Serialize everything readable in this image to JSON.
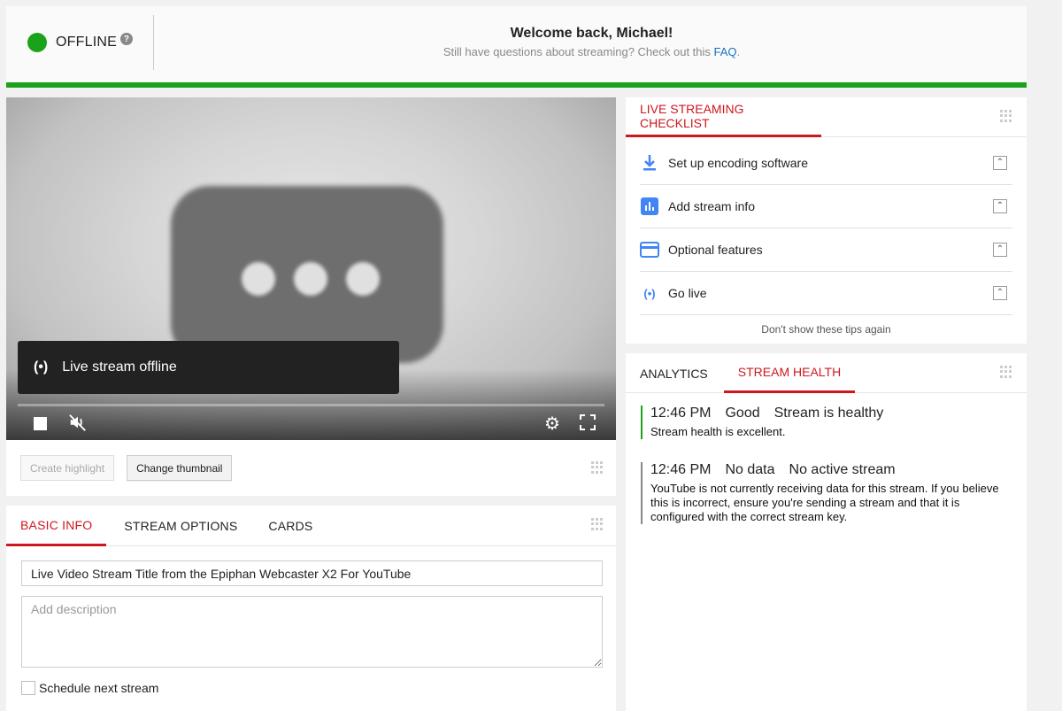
{
  "header": {
    "status": "OFFLINE",
    "help_icon": "?",
    "welcome_title": "Welcome back, Michael!",
    "welcome_sub_prefix": "Still have questions about streaming? Check out this ",
    "faq_link": "FAQ",
    "welcome_sub_suffix": ".",
    "status_color": "#1aa31a"
  },
  "player": {
    "offline_icon": "(•)",
    "offline_text": "Live stream offline",
    "mute_icon": "🔇",
    "gear_icon": "⚙",
    "create_highlight": "Create highlight",
    "change_thumbnail": "Change thumbnail"
  },
  "info": {
    "tabs": [
      "BASIC INFO",
      "STREAM OPTIONS",
      "CARDS"
    ],
    "title_value": "Live Video Stream Title from the Epiphan Webcaster X2 For YouTube",
    "description_placeholder": "Add description",
    "schedule_label": "Schedule next stream"
  },
  "checklist": {
    "title": "LIVE STREAMING CHECKLIST",
    "items": [
      {
        "label": "Set up encoding software",
        "icon": "⬇"
      },
      {
        "label": "Add stream info",
        "icon": "▮"
      },
      {
        "label": "Optional features",
        "icon": "▭"
      },
      {
        "label": "Go live",
        "icon": "(•)"
      }
    ],
    "expand_icon": "⌃",
    "dismiss": "Don't show these tips again"
  },
  "health": {
    "tabs": [
      "ANALYTICS",
      "STREAM HEALTH"
    ],
    "events": [
      {
        "time": "12:46 PM",
        "status": "Good",
        "summary": "Stream is healthy",
        "desc": "Stream health is excellent."
      },
      {
        "time": "12:46 PM",
        "status": "No data",
        "summary": "No active stream",
        "desc": "YouTube is not currently receiving data for this stream. If you believe this is incorrect, ensure you're sending a stream and that it is configured with the correct stream key."
      }
    ]
  }
}
